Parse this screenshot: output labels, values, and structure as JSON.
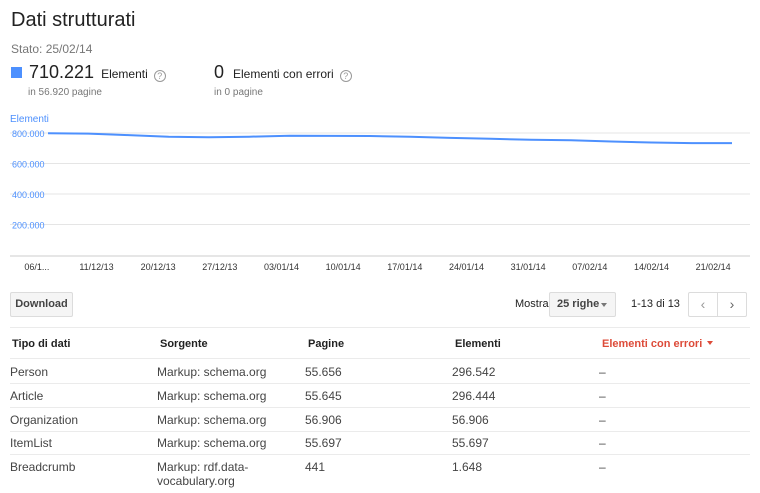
{
  "page": {
    "title": "Dati strutturati",
    "status": "Stato: 25/02/14"
  },
  "metrics": {
    "elements": {
      "value": "710.221",
      "label": "Elementi",
      "sub": "in 56.920 pagine",
      "help": "?"
    },
    "errors": {
      "value": "0",
      "label": "Elementi con errori",
      "sub": "in 0 pagine",
      "help": "?"
    }
  },
  "colors": {
    "accent": "#4d90fe",
    "error": "#dd4b39"
  },
  "chart_data": {
    "type": "line",
    "label": "Elementi",
    "y_ticks": [
      "800.000",
      "600.000",
      "400.000",
      "200.000"
    ],
    "ylim": [
      0,
      800000
    ],
    "x_ticks": [
      "06/1...",
      "11/12/13",
      "20/12/13",
      "27/12/13",
      "03/01/14",
      "10/01/14",
      "17/01/14",
      "24/01/14",
      "31/01/14",
      "07/02/14",
      "14/02/14",
      "21/02/14"
    ],
    "series": [
      {
        "values": [
          798000,
          796000,
          786000,
          776000,
          772000,
          776000,
          782000,
          781000,
          780000,
          775000,
          768000,
          762000,
          756000,
          752000,
          744000,
          738000,
          734000,
          734000
        ]
      }
    ],
    "grid": true
  },
  "toolbar": {
    "download": "Download",
    "mostra": "Mostra",
    "rows": "25 righe",
    "range": "1-13 di 13",
    "prev": "‹",
    "next": "›"
  },
  "table": {
    "headers": [
      "Tipo di dati",
      "Sorgente",
      "Pagine",
      "Elementi",
      "Elementi con errori"
    ],
    "rows": [
      [
        "Person",
        "Markup: schema.org",
        "55.656",
        "296.542",
        "–"
      ],
      [
        "Article",
        "Markup: schema.org",
        "55.645",
        "296.444",
        "–"
      ],
      [
        "Organization",
        "Markup: schema.org",
        "56.906",
        "56.906",
        "–"
      ],
      [
        "ItemList",
        "Markup: schema.org",
        "55.697",
        "55.697",
        "–"
      ],
      [
        "Breadcrumb",
        "Markup: rdf.data-vocabulary.org",
        "441",
        "1.648",
        "–"
      ]
    ]
  }
}
